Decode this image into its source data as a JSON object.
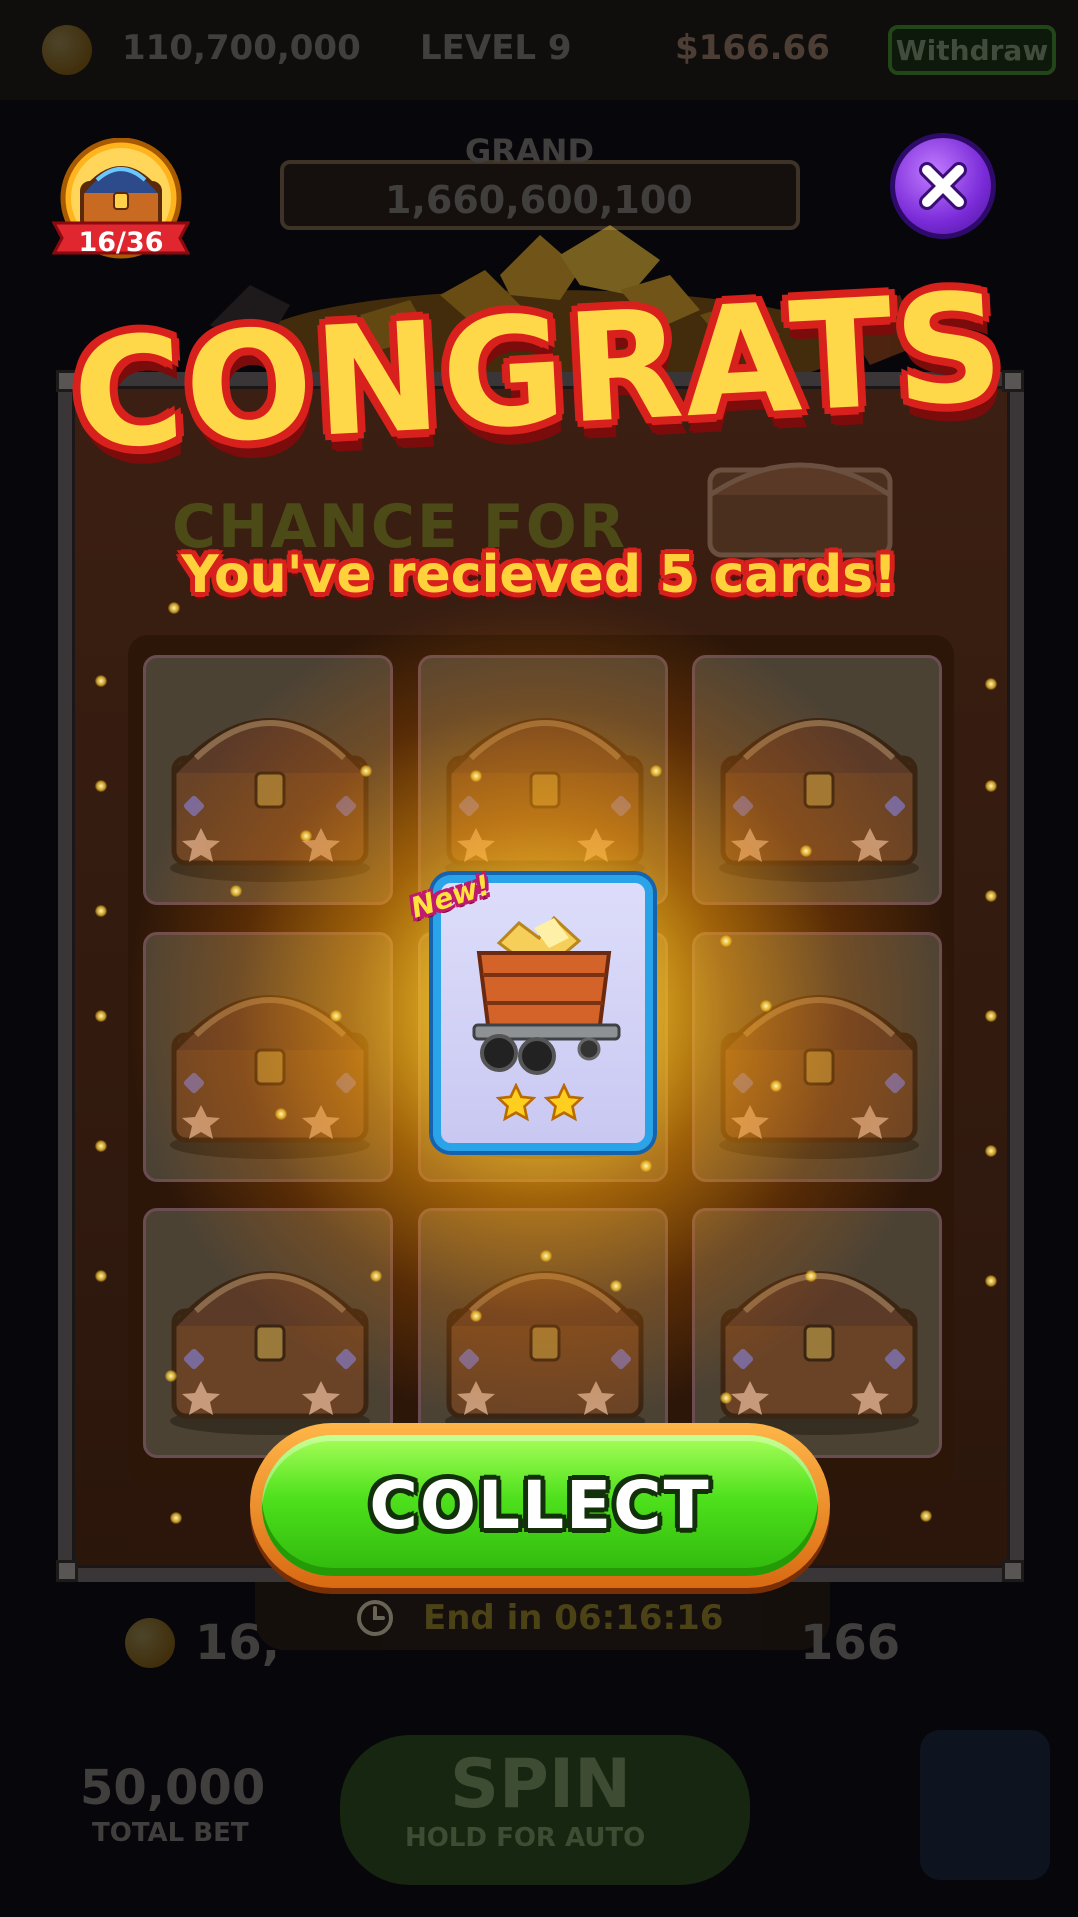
{
  "background": {
    "coins": "110,700,000",
    "level": "LEVEL 9",
    "cash": "$166.66",
    "withdraw_label": "Withdraw",
    "grand_label": "GRAND",
    "grand_value": "1,660,600,100",
    "bottom_coins": "16,",
    "bottom_cash": "166",
    "total_bet_value": "50,000",
    "total_bet_label": "TOTAL BET",
    "spin_label": "SPIN",
    "spin_sub_label": "HOLD FOR AUTO",
    "chance_for": "CHANCE FOR"
  },
  "popup": {
    "title": "CONGRATS",
    "subtitle": "You've recieved 5 cards!",
    "new_badge": "New!",
    "card_stars": 2,
    "collection_progress": "16/36",
    "collect_label": "COLLECT",
    "timer": "End in 06:16:16"
  },
  "icons": {
    "close": "close-icon",
    "chest": "chest-icon",
    "clock": "clock-icon",
    "mine_cart": "mine-cart-icon",
    "star": "star-icon"
  },
  "colors": {
    "title_fill": "#ffd84a",
    "title_outline": "#d8211c",
    "collect_green": "#4ee01c",
    "card_border": "#2aa3e8",
    "close_purple": "#7a2bd8"
  }
}
